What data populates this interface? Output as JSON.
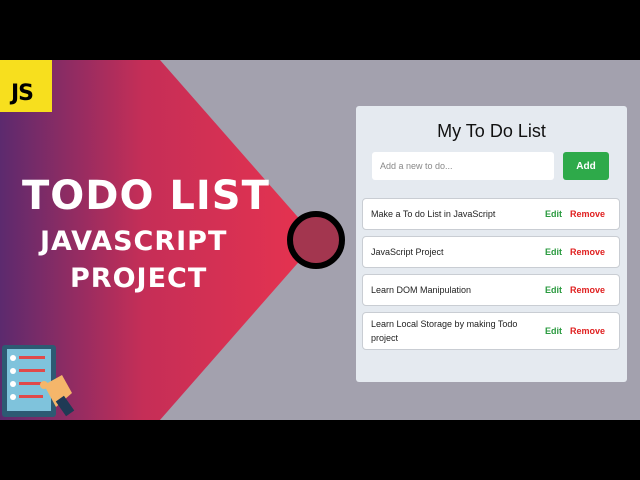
{
  "thumbnail": {
    "badge": "JS",
    "title_line1": "TODO LIST",
    "title_line2": "JAVASCRIPT",
    "title_line3": "PROJECT"
  },
  "app": {
    "title": "My To Do List",
    "input_placeholder": "Add a new to do...",
    "add_label": "Add",
    "items": [
      {
        "text": "Make a To do List in JavaScript",
        "edit": "Edit",
        "remove": "Remove"
      },
      {
        "text": "JavaScript Project",
        "edit": "Edit",
        "remove": "Remove"
      },
      {
        "text": "Learn DOM Manipulation",
        "edit": "Edit",
        "remove": "Remove"
      },
      {
        "text": "Learn Local Storage by making Todo project",
        "edit": "Edit",
        "remove": "Remove"
      }
    ]
  },
  "colors": {
    "gradient_start": "#5c2a6e",
    "gradient_end": "#e8334f",
    "background": "#a3a1ae",
    "badge": "#f7df1e",
    "add_button": "#2eaa4a",
    "edit": "#2a9a3f",
    "remove": "#e02020"
  }
}
